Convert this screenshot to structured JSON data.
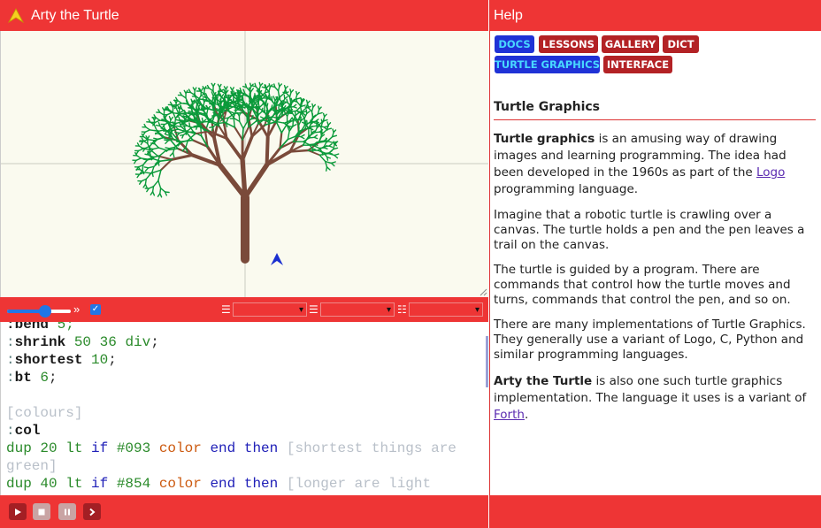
{
  "app": {
    "title": "Arty the Turtle",
    "help_title": "Help",
    "brand_color": "#ee3535"
  },
  "canvas": {
    "tree_trunk_color": "#854",
    "leaf_color": "#093",
    "background": "#fafaef",
    "turtle_icon": "turtle-arrow-icon"
  },
  "toolbar": {
    "speed_value": 0.6,
    "speed_symbol": "»",
    "checkbox_checked": true,
    "selects": [
      "",
      "",
      ""
    ]
  },
  "editor": {
    "lines": [
      [
        {
          "t": ":bend",
          "c": "kw-def"
        },
        {
          "t": " 5;",
          "c": "col-green"
        }
      ],
      [
        {
          "t": ":",
          "c": "col-teal"
        },
        {
          "t": "shrink",
          "c": "kw-def"
        },
        {
          "t": " 50 36 ",
          "c": "col-green"
        },
        {
          "t": "div",
          "c": "col-green"
        },
        {
          "t": ";",
          "c": "col-dark"
        }
      ],
      [
        {
          "t": ":",
          "c": "col-teal"
        },
        {
          "t": "shortest",
          "c": "kw-def"
        },
        {
          "t": " 10",
          "c": "col-green"
        },
        {
          "t": ";",
          "c": "col-dark"
        }
      ],
      [
        {
          "t": ":",
          "c": "col-teal"
        },
        {
          "t": "bt",
          "c": "kw-def"
        },
        {
          "t": " 6",
          "c": "col-green"
        },
        {
          "t": ";",
          "c": "col-dark"
        }
      ],
      [],
      [
        {
          "t": "[colours]",
          "c": "col-gray"
        }
      ],
      [
        {
          "t": ":",
          "c": "col-teal"
        },
        {
          "t": "col",
          "c": "kw-def"
        }
      ],
      [
        {
          "t": "dup 20 lt ",
          "c": "col-green"
        },
        {
          "t": "if",
          "c": "col-blue"
        },
        {
          "t": " #093 ",
          "c": "col-green"
        },
        {
          "t": "color",
          "c": "col-orange"
        },
        {
          "t": " end",
          "c": "col-blue"
        },
        {
          "t": " then",
          "c": "col-blue"
        },
        {
          "t": " [shortest things are",
          "c": "col-gray"
        }
      ],
      [
        {
          "t": "green]",
          "c": "col-gray"
        }
      ],
      [
        {
          "t": "dup 40 lt ",
          "c": "col-green"
        },
        {
          "t": "if",
          "c": "col-blue"
        },
        {
          "t": " #854 ",
          "c": "col-green"
        },
        {
          "t": "color",
          "c": "col-orange"
        },
        {
          "t": " end",
          "c": "col-blue"
        },
        {
          "t": " then",
          "c": "col-blue"
        },
        {
          "t": " [longer are light",
          "c": "col-gray"
        }
      ]
    ]
  },
  "controls": {
    "run": "play-icon",
    "stop": "stop-icon",
    "pause": "pause-icon",
    "step": "step-icon"
  },
  "help": {
    "tabs": [
      {
        "label": "DOCS",
        "style": "blue"
      },
      {
        "label": "LESSONS",
        "style": "red"
      },
      {
        "label": "GALLERY",
        "style": "red"
      },
      {
        "label": "DICT",
        "style": "red"
      },
      {
        "label": "TURTLE GRAPHICS",
        "style": "blue"
      },
      {
        "label": "INTERFACE",
        "style": "red"
      }
    ],
    "heading": "Turtle Graphics",
    "p1_bold": "Turtle graphics",
    "p1_text": " is an amusing way of drawing images and learning programming. The idea had been developed in the 1960s as part of the ",
    "p1_link": "Logo",
    "p1_end": " programming language.",
    "p2": "Imagine that a robotic turtle is crawling over a canvas. The turtle holds a pen and the pen leaves a trail on the canvas.",
    "p3": "The turtle is guided by a program. There are commands that control how the turtle moves and turns, commands that control the pen, and so on.",
    "p4": "There are many implementations of Turtle Graphics. They generally use a variant of Logo, C, Python and similar programming languages.",
    "p5_bold": "Arty the Turtle",
    "p5_text": " is also one such turtle graphics implementation. The language it uses is a variant of ",
    "p5_link": "Forth",
    "p5_end": "."
  }
}
